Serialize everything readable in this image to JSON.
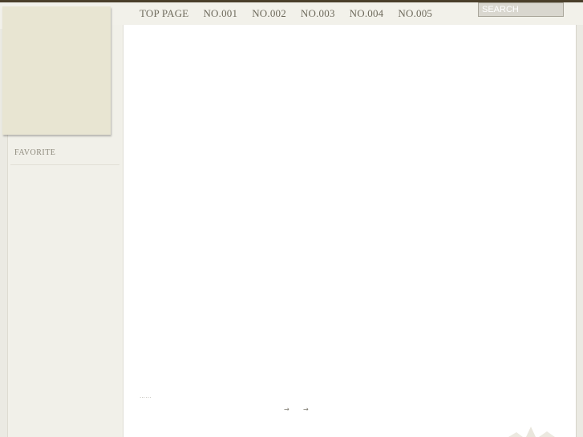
{
  "nav": {
    "items": [
      "TOP PAGE",
      "NO.001",
      "NO.002",
      "NO.003",
      "NO.004",
      "NO.005"
    ]
  },
  "search": {
    "placeholder": "SEARCH"
  },
  "sidebar": {
    "favorite_label": "FAVORITE"
  },
  "footer": {
    "dots": "……",
    "arrow_prev": "→",
    "arrow_next": "→"
  },
  "colors": {
    "top_bar": "#4a3f2a",
    "background": "#f2f1ea",
    "logo_box": "#e8e5d2",
    "panel": "#ffffff",
    "nav_text": "#6e6a5c"
  },
  "icons": {
    "decoration": "star-decoration-icon"
  }
}
